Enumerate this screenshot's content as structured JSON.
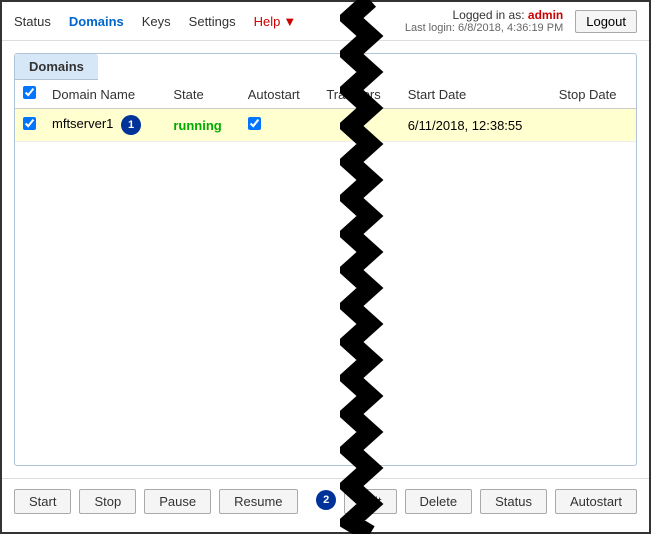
{
  "nav": {
    "items": [
      {
        "label": "Status",
        "active": false
      },
      {
        "label": "Domains",
        "active": true
      },
      {
        "label": "Keys",
        "active": false
      },
      {
        "label": "Settings",
        "active": false
      },
      {
        "label": "Help",
        "active": false
      }
    ]
  },
  "header": {
    "logged_in_label": "Logged in as:",
    "username": "admin",
    "last_login_label": "Last login:",
    "last_login_value": "6/8/2018, 4:36:19 PM",
    "logout_label": "Logout"
  },
  "panel": {
    "tab_label": "Domains",
    "table": {
      "columns": [
        "Domain Name",
        "State",
        "Autostart",
        "Transfers",
        "Start Date",
        "Stop Date"
      ],
      "rows": [
        {
          "selected": true,
          "domain_name": "mftserver1",
          "badge": "1",
          "state": "running",
          "autostart": true,
          "transfers": "",
          "start_date": "6/11/2018, 12:38:55",
          "stop_date": ""
        }
      ]
    }
  },
  "toolbar": {
    "start_label": "Start",
    "stop_label": "Stop",
    "pause_label": "Pause",
    "resume_label": "Resume",
    "badge2": "2",
    "edit_label": "Edit",
    "delete_label": "Delete",
    "status_label": "Status",
    "autostart_label": "Autostart"
  }
}
